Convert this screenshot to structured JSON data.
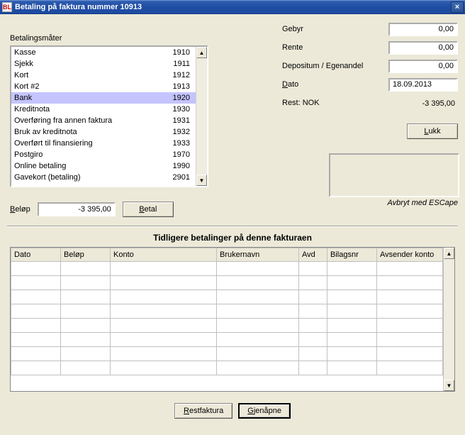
{
  "window": {
    "app_icon_text": "BL",
    "title": "Betaling på faktura nummer 10913",
    "close_glyph": "×"
  },
  "left": {
    "heading": "Betalingsmåter",
    "items": [
      {
        "name": "Kasse",
        "code": "1910",
        "selected": false
      },
      {
        "name": "Sjekk",
        "code": "1911",
        "selected": false
      },
      {
        "name": "Kort",
        "code": "1912",
        "selected": false
      },
      {
        "name": "Kort #2",
        "code": "1913",
        "selected": false
      },
      {
        "name": "Bank",
        "code": "1920",
        "selected": true
      },
      {
        "name": "Kreditnota",
        "code": "1930",
        "selected": false
      },
      {
        "name": "Overføring fra annen faktura",
        "code": "1931",
        "selected": false
      },
      {
        "name": "Bruk av kreditnota",
        "code": "1932",
        "selected": false
      },
      {
        "name": "Overført til finansiering",
        "code": "1933",
        "selected": false
      },
      {
        "name": "Postgiro",
        "code": "1970",
        "selected": false
      },
      {
        "name": "Online betaling",
        "code": "1990",
        "selected": false
      },
      {
        "name": "Gavekort (betaling)",
        "code": "2901",
        "selected": false
      }
    ],
    "amount_label_prefix": "B",
    "amount_label_rest": "eløp",
    "amount_value": "-3 395,00",
    "betal_label_prefix": "B",
    "betal_label_rest": "etal"
  },
  "right": {
    "rows": [
      {
        "label": "Gebyr",
        "value": "0,00"
      },
      {
        "label": "Rente",
        "value": "0,00"
      },
      {
        "label": "Depositum / Egenandel",
        "value": "0,00"
      }
    ],
    "date_label_prefix": "D",
    "date_label_rest": "ato",
    "date_value": "18.09.2013",
    "rest_label": "Rest: NOK",
    "rest_value": "-3 395,00",
    "lukk_prefix": "L",
    "lukk_rest": "ukk",
    "escape_note": "Avbryt med ESCape"
  },
  "history": {
    "title": "Tidligere betalinger på denne fakturaen",
    "columns": [
      "Dato",
      "Beløp",
      "Konto",
      "Brukernavn",
      "Avd",
      "Bilagsnr",
      "Avsender konto"
    ]
  },
  "footer": {
    "restfaktura_prefix": "R",
    "restfaktura_rest": "estfaktura",
    "gjenapne_prefix": "G",
    "gjenapne_rest": "jenåpne"
  },
  "scroll": {
    "up": "▲",
    "down": "▼"
  }
}
